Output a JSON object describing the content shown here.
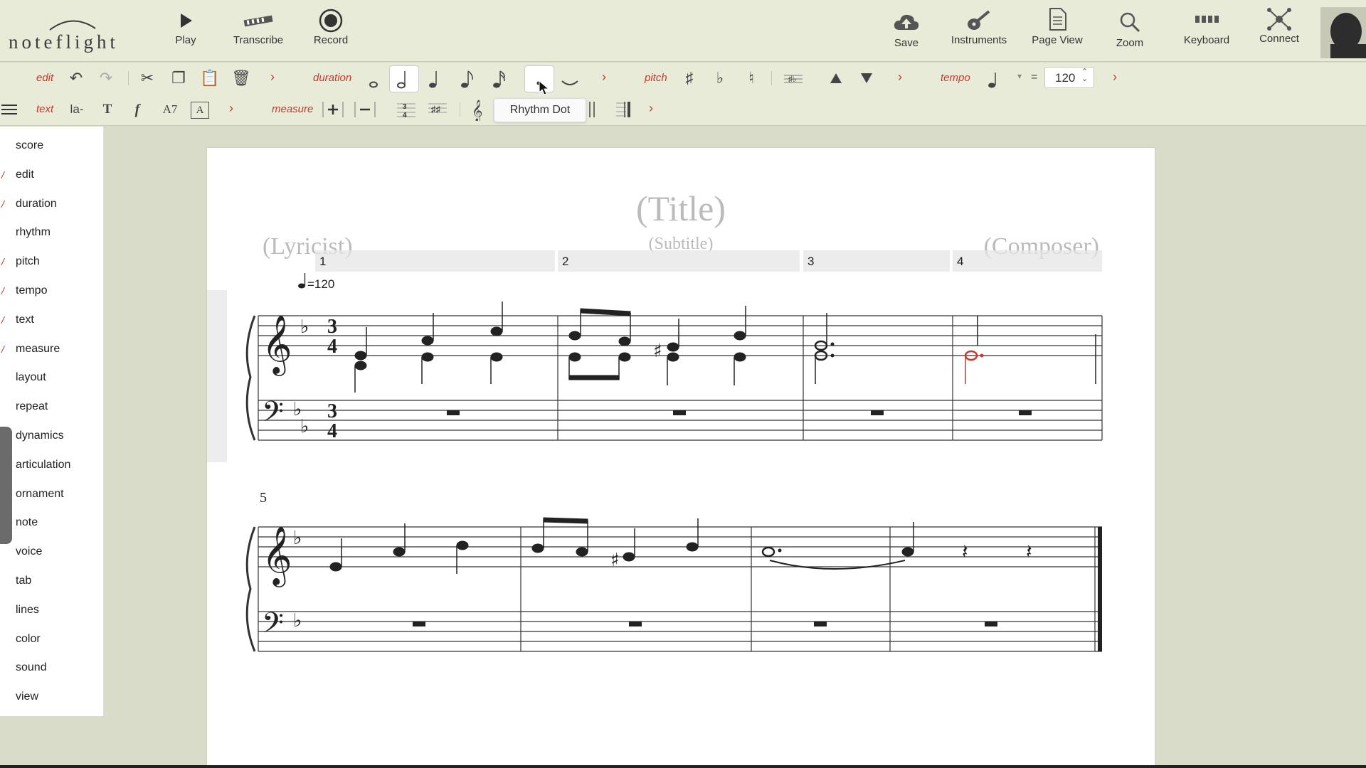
{
  "app": {
    "logo": "noteflight"
  },
  "toolbar": {
    "left": [
      {
        "label": "Play",
        "icon": "play-icon"
      },
      {
        "label": "Transcribe",
        "icon": "transcribe-icon"
      },
      {
        "label": "Record",
        "icon": "record-icon"
      }
    ],
    "right": [
      {
        "label": "Save",
        "icon": "cloud-save-icon"
      },
      {
        "label": "Instruments",
        "icon": "guitar-icon"
      },
      {
        "label": "Page View",
        "icon": "page-icon"
      },
      {
        "label": "Zoom",
        "icon": "magnifier-icon"
      },
      {
        "label": "Keyboard",
        "icon": "keyboard-icon"
      },
      {
        "label": "Connect",
        "icon": "network-icon"
      }
    ]
  },
  "ribbon": {
    "sections_row1": [
      "edit",
      "duration",
      "pitch",
      "tempo"
    ],
    "sections_row2": [
      "text",
      "measure"
    ],
    "text_tools": [
      "la-",
      "T",
      "f",
      "A7",
      "A"
    ],
    "tempo_value": "120",
    "tooltip": "Rhythm Dot"
  },
  "sidebar": {
    "items": [
      {
        "label": "score",
        "checked": false
      },
      {
        "label": "edit",
        "checked": true
      },
      {
        "label": "duration",
        "checked": true
      },
      {
        "label": "rhythm",
        "checked": false
      },
      {
        "label": "pitch",
        "checked": true
      },
      {
        "label": "tempo",
        "checked": true
      },
      {
        "label": "text",
        "checked": true
      },
      {
        "label": "measure",
        "checked": true
      },
      {
        "label": "layout",
        "checked": false
      },
      {
        "label": "repeat",
        "checked": false
      },
      {
        "label": "dynamics",
        "checked": false
      },
      {
        "label": "articulation",
        "checked": false
      },
      {
        "label": "ornament",
        "checked": false
      },
      {
        "label": "note",
        "checked": false
      },
      {
        "label": "voice",
        "checked": false
      },
      {
        "label": "tab",
        "checked": false
      },
      {
        "label": "lines",
        "checked": false
      },
      {
        "label": "color",
        "checked": false
      },
      {
        "label": "sound",
        "checked": false
      },
      {
        "label": "view",
        "checked": false
      }
    ]
  },
  "score": {
    "title": "(Title)",
    "subtitle": "(Subtitle)",
    "lyricist": "(Lyricist)",
    "composer": "(Composer)",
    "measure_numbers": [
      "1",
      "2",
      "3",
      "4"
    ],
    "system2_number": "5",
    "tempo_mark": "=120",
    "time_signature": "3\n4",
    "accent_color": "#c5392e"
  }
}
